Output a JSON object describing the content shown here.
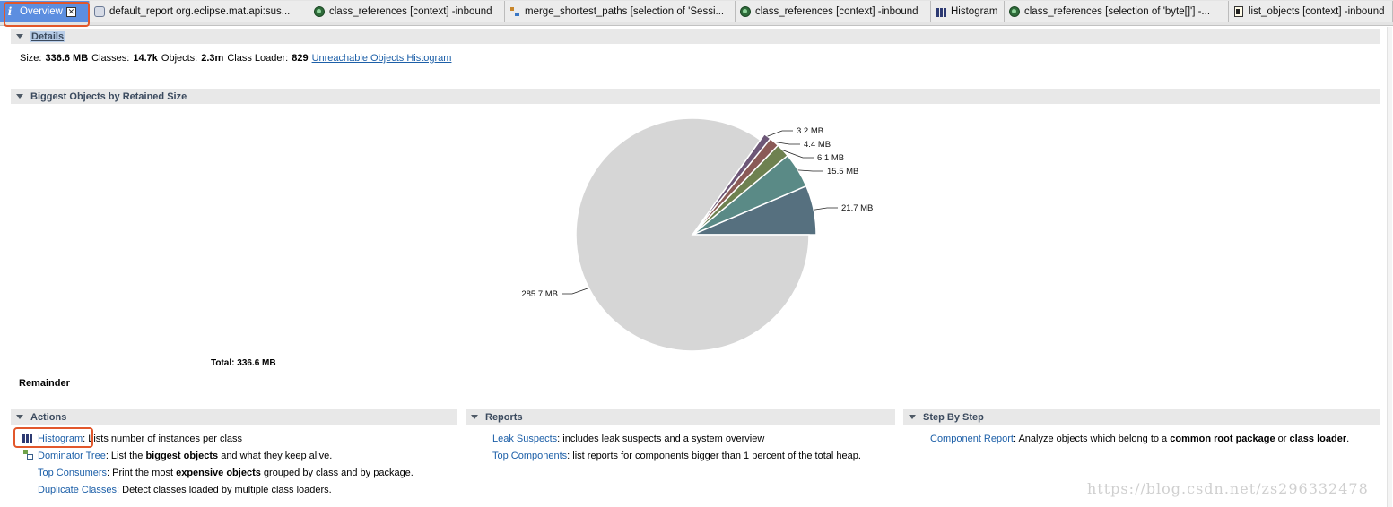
{
  "tabs": [
    {
      "label": "Overview",
      "icon": "info-icon",
      "active": true
    },
    {
      "label": "default_report  org.eclipse.mat.api:sus...",
      "icon": "report-icon"
    },
    {
      "label": "class_references [context] -inbound",
      "icon": "query-icon"
    },
    {
      "label": "merge_shortest_paths [selection of 'Sessi...",
      "icon": "tree-icon"
    },
    {
      "label": "class_references [context] -inbound",
      "icon": "query-icon"
    },
    {
      "label": "Histogram",
      "icon": "histogram-icon"
    },
    {
      "label": "class_references [selection of 'byte[]'] -...",
      "icon": "query-icon"
    },
    {
      "label": "list_objects [context] -inbound",
      "icon": "list-icon"
    }
  ],
  "details": {
    "header": "Details",
    "size_label": "Size:",
    "size_value": "336.6 MB",
    "classes_label": "Classes:",
    "classes_value": "14.7k",
    "objects_label": "Objects:",
    "objects_value": "2.3m",
    "loader_label": "Class Loader:",
    "loader_value": "829",
    "unreachable_link": "Unreachable Objects Histogram"
  },
  "biggest": {
    "header": "Biggest Objects by Retained Size",
    "total_label": "Total: 336.6 MB",
    "remainder_label": "Remainder"
  },
  "chart_data": {
    "type": "pie",
    "slices": [
      {
        "label": "21.7 MB",
        "value": 21.7,
        "color": "#56707f"
      },
      {
        "label": "15.5 MB",
        "value": 15.5,
        "color": "#5a8a86"
      },
      {
        "label": "6.1 MB",
        "value": 6.1,
        "color": "#6e8150"
      },
      {
        "label": "4.4 MB",
        "value": 4.4,
        "color": "#8a5a56"
      },
      {
        "label": "3.2 MB",
        "value": 3.2,
        "color": "#6d5777"
      },
      {
        "label": "285.7 MB",
        "value": 285.7,
        "color": "#d6d6d6"
      }
    ],
    "total": 336.6
  },
  "actions": {
    "header": "Actions",
    "items": [
      {
        "link": "Histogram",
        "text_a": ": Lists number of instances per class",
        "bold": "",
        "text_b": ""
      },
      {
        "link": "Dominator Tree",
        "text_a": ": List the ",
        "bold": "biggest objects",
        "text_b": " and what they keep alive."
      },
      {
        "link": "Top Consumers",
        "text_a": ": Print the most ",
        "bold": "expensive objects",
        "text_b": " grouped by class and by package."
      },
      {
        "link": "Duplicate Classes",
        "text_a": ": Detect classes loaded by multiple class loaders.",
        "bold": "",
        "text_b": ""
      }
    ]
  },
  "reports": {
    "header": "Reports",
    "items": [
      {
        "link": "Leak Suspects",
        "text": ": includes leak suspects and a system overview"
      },
      {
        "link": "Top Components",
        "text": ": list reports for components bigger than 1 percent of the total heap."
      }
    ]
  },
  "stepbystep": {
    "header": "Step By Step",
    "link": "Component Report",
    "text_a": ": Analyze objects which belong to a ",
    "bold_a": "common root package",
    "text_b": " or ",
    "bold_b": "class loader",
    "text_c": "."
  },
  "watermark": "https://blog.csdn.net/zs296332478"
}
